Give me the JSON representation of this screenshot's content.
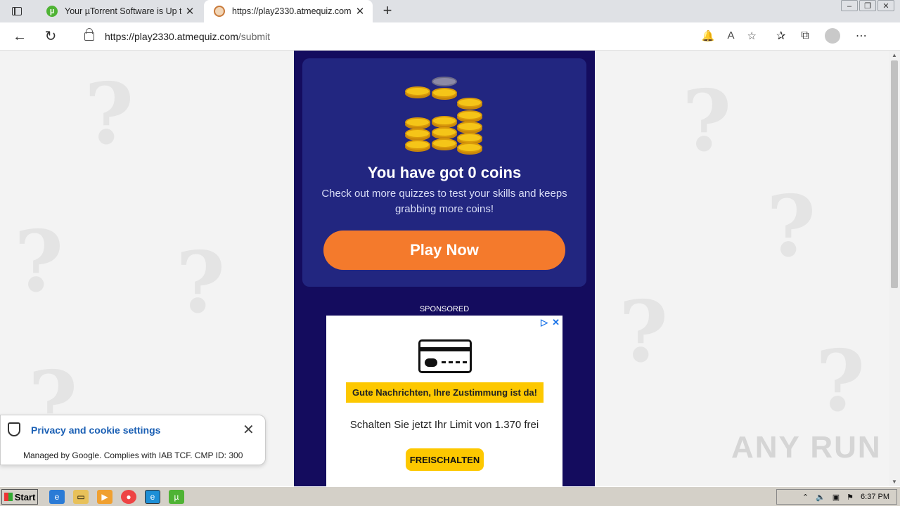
{
  "browser": {
    "tabs": [
      {
        "title": "Your µTorrent Software is Up to",
        "favicon": "utorrent-icon"
      },
      {
        "title": "https://play2330.atmequiz.com",
        "favicon": "atmequiz-icon"
      }
    ],
    "url_host": "https://play2330.atmequiz.com",
    "url_path": "/submit"
  },
  "card": {
    "title": "You have got 0 coins",
    "subtitle": "Check out more quizzes to test your skills and keeps grabbing more coins!",
    "play_button": "Play Now"
  },
  "ad": {
    "sponsored_label": "SPONSORED",
    "banner": "Gute Nachrichten, Ihre Zustimmung ist da!",
    "text": "Schalten Sie jetzt Ihr Limit von 1.370 frei",
    "button": "FREISCHALTEN"
  },
  "cookie": {
    "title": "Privacy and cookie settings",
    "description": "Managed by Google. Complies with IAB TCF. CMP ID: 300"
  },
  "watermark": "ANY RUN",
  "taskbar": {
    "start_label": "Start",
    "clock": "6:37 PM"
  },
  "colors": {
    "column_bg": "#140c5e",
    "card_bg": "#222680",
    "play_button": "#f47a2c",
    "ad_yellow": "#fdc800"
  }
}
